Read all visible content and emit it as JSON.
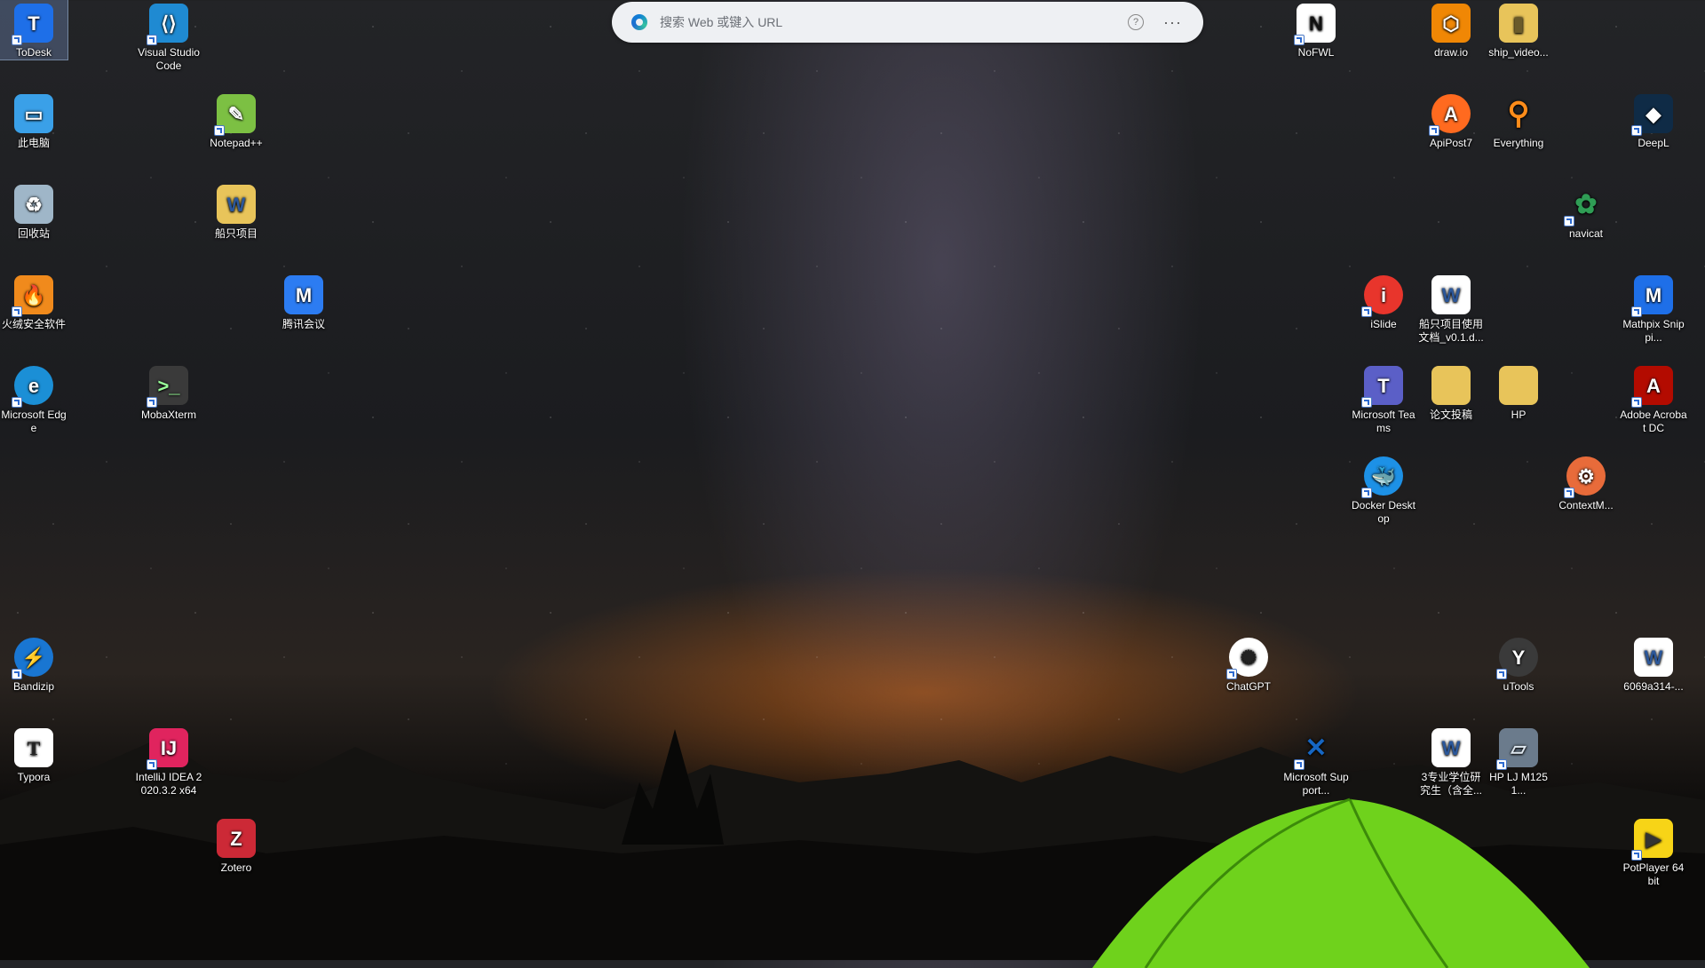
{
  "search": {
    "placeholder": "搜索 Web 或键入 URL",
    "help": "?",
    "more": "···"
  },
  "icons": {
    "todesk": "ToDesk",
    "vscode": "Visual Studio Code",
    "thispc": "此电脑",
    "notepadpp": "Notepad++",
    "recycle": "回收站",
    "shipproject": "船只项目",
    "huorong": "火绒安全软件",
    "tencentmeeting": "腾讯会议",
    "edge": "Microsoft Edge",
    "mobaxterm": "MobaXterm",
    "bandizip": "Bandizip",
    "typora": "Typora",
    "intellij": "IntelliJ IDEA 2020.3.2 x64",
    "zotero": "Zotero",
    "nofwl": "NoFWL",
    "drawio": "draw.io",
    "shipvideo": "ship_video...",
    "apipost": "ApiPost7",
    "everything": "Everything",
    "deepl": "DeepL",
    "navicat": "navicat",
    "islide": "iSlide",
    "shipdoc": "船只项目使用文档_v0.1.d...",
    "mathpix": "Mathpix Snippi...",
    "teams": "Microsoft Teams",
    "paper": "论文投稿",
    "hp": "HP",
    "acrobat": "Adobe Acrobat DC",
    "docker": "Docker Desktop",
    "contextm": "ContextM...",
    "chatgpt": "ChatGPT",
    "utools": "uTools",
    "doc6069": "6069a314-...",
    "mssupport": "Microsoft Support...",
    "doc3major": "3专业学位研究生（含全...",
    "hplj": "HP LJ M1251...",
    "potplayer": "PotPlayer 64 bit"
  },
  "colors": {
    "todesk": "#1e6fe8",
    "vscode": "#1f8ad2",
    "thispc": "#3aa0e8",
    "notepadpp": "#7cc043",
    "recycle": "#9fb6c8",
    "shipproject": "#e8c45a",
    "huorong": "#f08a1c",
    "tencentmeeting": "#2c7cf2",
    "edge": "#1b8fd6",
    "mobaxterm": "#3a3a3a",
    "bandizip": "#1976d2",
    "typora": "#ffffff",
    "intellij": "#e0245e",
    "zotero": "#cc2936",
    "nofwl": "#ffffff",
    "drawio": "#f08705",
    "shipvideo": "#e8c45a",
    "apipost": "#ff6a1f",
    "everything": "#ff8c1a",
    "deepl": "#0f2b46",
    "navicat": "#2f9d55",
    "islide": "#e8352c",
    "shipdoc": "#2b579a",
    "mathpix": "#1e6fe8",
    "teams": "#5b5fc7",
    "paper": "#e8c45a",
    "hp": "#e8c45a",
    "acrobat": "#b30b00",
    "docker": "#1d91e6",
    "contextm": "#e86b3a",
    "chatgpt": "#ffffff",
    "utools": "#3a3a3a",
    "doc6069": "#2b579a",
    "mssupport": "#1666c2",
    "doc3major": "#2b579a",
    "hplj": "#6b7b8c",
    "potplayer": "#f7d417"
  }
}
